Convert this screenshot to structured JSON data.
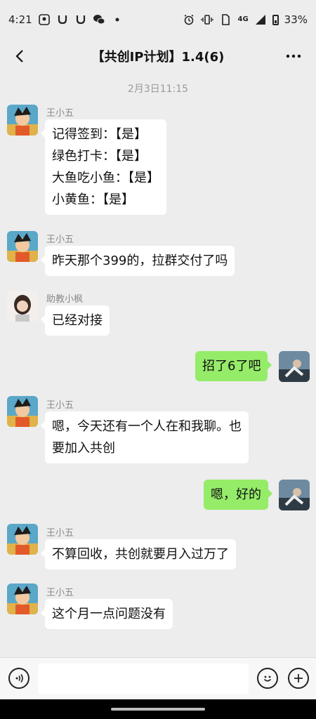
{
  "status_bar": {
    "time": "4:21",
    "network": "4G",
    "battery": "33%"
  },
  "header": {
    "title": "【共创IP计划】1.4(6)"
  },
  "chat": {
    "timestamp": "2月3日11:15",
    "messages": [
      {
        "sender": "王小五",
        "lines": [
          "记得签到：【是】",
          "绿色打卡：【是】",
          "大鱼吃小鱼：【是】",
          "小黄鱼：【是】"
        ]
      },
      {
        "sender": "王小五",
        "lines": [
          "昨天那个399的，拉群交付了吗"
        ]
      },
      {
        "sender": "助教小枫",
        "lines": [
          "已经对接"
        ]
      },
      {
        "sender": "",
        "lines": [
          "招了6了吧"
        ]
      },
      {
        "sender": "王小五",
        "lines": [
          "嗯，今天还有一个人在和我聊。也",
          "要加入共创"
        ]
      },
      {
        "sender": "",
        "lines": [
          "嗯，好的"
        ]
      },
      {
        "sender": "王小五",
        "lines": [
          "不算回收，共创就要月入过万了"
        ]
      },
      {
        "sender": "王小五",
        "lines": [
          "这个月一点问题没有"
        ]
      }
    ]
  },
  "input_bar": {
    "placeholder": ""
  },
  "icons": {
    "back": "back-arrow-icon",
    "more": "more-icon",
    "voice": "voice-icon",
    "emoji": "emoji-icon",
    "plus": "plus-icon"
  },
  "colors": {
    "background": "#ededed",
    "incoming_bubble": "#ffffff",
    "outgoing_bubble": "#95ec69"
  }
}
